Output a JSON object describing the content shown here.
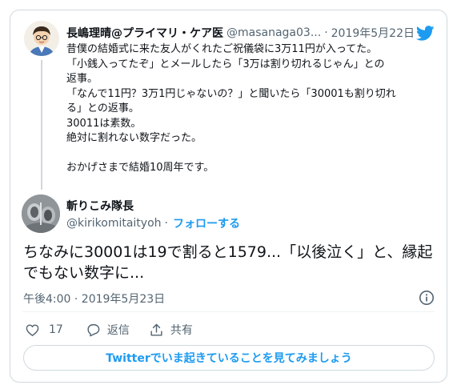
{
  "quoted_tweet": {
    "author_name": "長嶋理晴@プライマリ・ケア医",
    "author_handle": "@masanaga03...",
    "separator": "·",
    "date": "2019年5月22日",
    "lines": [
      "昔僕の結婚式に来た友人がくれたご祝儀袋に3万11円が入ってた。",
      "「小銭入ってたぞ」とメールしたら「3万は割り切れるじゃん」との",
      "返事。",
      "「なんで11円？3万1円じゃないの？」と聞いたら「30001も割り切れ",
      "る」との返事。",
      "30011は素数。",
      "絶対に割れない数字だった。",
      "",
      "おかげさまで結婚10周年です。"
    ]
  },
  "reply_tweet": {
    "author_name": "斬りこみ隊長",
    "author_handle": "@kirikomitaityoh",
    "separator": "·",
    "follow_label": "フォローする",
    "lines": [
      "ちなみに30001は19で割ると1579...「以後泣く」と、縁起",
      "でもない数字に..."
    ],
    "timestamp": "午後4:00 · 2019年5月23日"
  },
  "actions": {
    "like_count": "17",
    "reply_label": "返信",
    "share_label": "共有"
  },
  "cta_label": "Twitterでいま起きていることを見てみましょう",
  "icons": {
    "brand": "twitter-bird-icon",
    "info": "info-icon",
    "like": "heart-icon",
    "reply": "reply-icon",
    "share": "share-icon"
  },
  "colors": {
    "accent": "#1d9bf0",
    "text_primary": "#0f1419",
    "text_secondary": "#536471",
    "border": "#cfd9de"
  }
}
